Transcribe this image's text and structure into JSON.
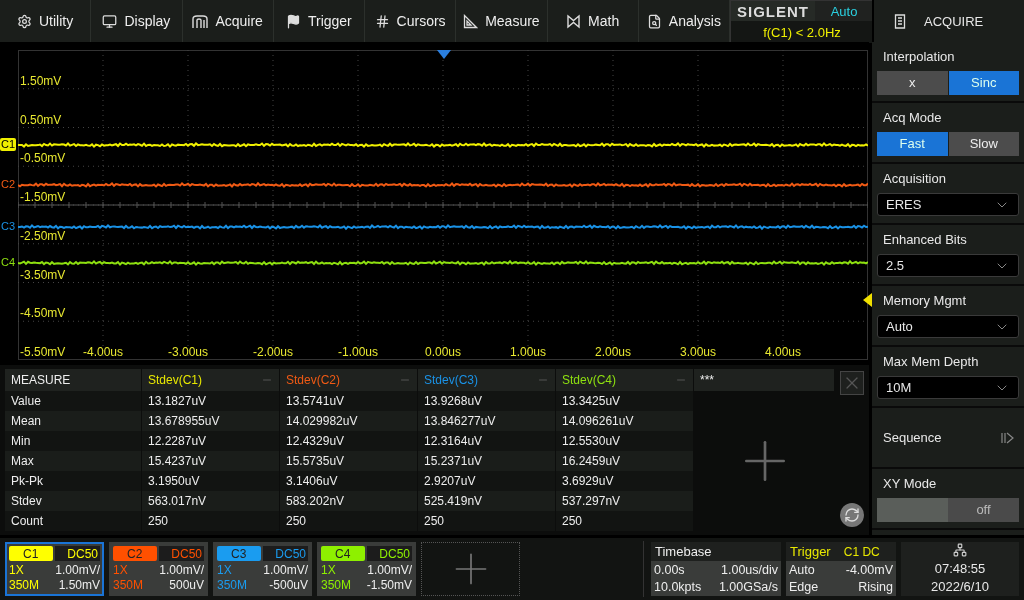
{
  "menu": [
    {
      "label": "Utility",
      "kind": "gear"
    },
    {
      "label": "Display",
      "kind": "monitor"
    },
    {
      "label": "Acquire",
      "kind": "acquire"
    },
    {
      "label": "Trigger",
      "kind": "flag"
    },
    {
      "label": "Cursors",
      "kind": "cursors"
    },
    {
      "label": "Measure",
      "kind": "measure"
    },
    {
      "label": "Math",
      "kind": "math"
    },
    {
      "label": "Analysis",
      "kind": "analysis"
    }
  ],
  "brand": {
    "logo": "SIGLENT",
    "trigger_status": "Auto",
    "frequency": "f(C1) < 2.0Hz"
  },
  "scope": {
    "y_labels": [
      "1.50mV",
      "0.50mV",
      "-0.50mV",
      "-1.50mV",
      "-2.50mV",
      "-3.50mV",
      "-4.50mV",
      "-5.50mV"
    ],
    "x_labels": [
      "-4.00us",
      "-3.00us",
      "-2.00us",
      "-1.00us",
      "0.00us",
      "1.00us",
      "2.00us",
      "3.00us",
      "4.00us"
    ],
    "traces": [
      {
        "label": "C1",
        "color": "#f0f000",
        "selected": true
      },
      {
        "label": "C2",
        "color": "#f05a14",
        "selected": false
      },
      {
        "label": "C3",
        "color": "#1a92e6",
        "selected": false
      },
      {
        "label": "C4",
        "color": "#8ee010",
        "selected": false
      }
    ]
  },
  "measure": {
    "title": "MEASURE",
    "columns": [
      {
        "label": "Stdev(C1)",
        "color": "#e8e800"
      },
      {
        "label": "Stdev(C2)",
        "color": "#f05a14"
      },
      {
        "label": "Stdev(C3)",
        "color": "#1a92e6"
      },
      {
        "label": "Stdev(C4)",
        "color": "#8ee010"
      }
    ],
    "extra_column": "***",
    "rows": [
      {
        "label": "Value",
        "cells": [
          "13.1827uV",
          "13.5741uV",
          "13.9268uV",
          "13.3425uV"
        ]
      },
      {
        "label": "Mean",
        "cells": [
          "13.678955uV",
          "14.029982uV",
          "13.846277uV",
          "14.096261uV"
        ]
      },
      {
        "label": "Min",
        "cells": [
          "12.2287uV",
          "12.4329uV",
          "12.3164uV",
          "12.5530uV"
        ]
      },
      {
        "label": "Max",
        "cells": [
          "15.4237uV",
          "15.5735uV",
          "15.2371uV",
          "16.2459uV"
        ]
      },
      {
        "label": "Pk-Pk",
        "cells": [
          "3.1950uV",
          "3.1406uV",
          "2.9207uV",
          "3.6929uV"
        ]
      },
      {
        "label": "Stdev",
        "cells": [
          "563.017nV",
          "583.202nV",
          "525.419nV",
          "537.297nV"
        ]
      },
      {
        "label": "Count",
        "cells": [
          "250",
          "250",
          "250",
          "250"
        ]
      }
    ]
  },
  "panel": {
    "title": "ACQUIRE",
    "items": [
      {
        "kind": "toggle",
        "label": "Interpolation",
        "options": [
          {
            "label": "x",
            "selected": false
          },
          {
            "label": "Sinc",
            "selected": true
          }
        ]
      },
      {
        "kind": "toggle",
        "label": "Acq Mode",
        "options": [
          {
            "label": "Fast",
            "selected": true
          },
          {
            "label": "Slow",
            "selected": false
          }
        ]
      },
      {
        "kind": "dropdown",
        "label": "Acquisition",
        "value": "ERES"
      },
      {
        "kind": "dropdown",
        "label": "Enhanced Bits",
        "value": "2.5"
      },
      {
        "kind": "dropdown",
        "label": "Memory Mgmt",
        "value": "Auto"
      },
      {
        "kind": "dropdown",
        "label": "Max Mem Depth",
        "value": "10M"
      },
      {
        "kind": "link",
        "label": "Sequence"
      },
      {
        "kind": "switch",
        "label": "XY Mode",
        "state_label": "off",
        "on": false
      }
    ]
  },
  "channels": [
    {
      "name": "C1",
      "coupling": "DC50",
      "color": "#ffff00",
      "probe": "1X",
      "scale": "1.00mV/",
      "bandwidth": "350M",
      "offset": "1.50mV",
      "selected": true
    },
    {
      "name": "C2",
      "coupling": "DC50",
      "color": "#ff5000",
      "probe": "1X",
      "scale": "1.00mV/",
      "bandwidth": "350M",
      "offset": "500uV",
      "selected": false
    },
    {
      "name": "C3",
      "coupling": "DC50",
      "color": "#1a9cf0",
      "probe": "1X",
      "scale": "1.00mV/",
      "bandwidth": "350M",
      "offset": "-500uV",
      "selected": false
    },
    {
      "name": "C4",
      "coupling": "DC50",
      "color": "#8ef000",
      "probe": "1X",
      "scale": "1.00mV/",
      "bandwidth": "350M",
      "offset": "-1.50mV",
      "selected": false
    }
  ],
  "timebase": {
    "title": "Timebase",
    "delay": "0.00s",
    "scale": "1.00us/div",
    "points": "10.0kpts",
    "sample_rate": "1.00GSa/s"
  },
  "trigger": {
    "title": "Trigger",
    "source": "C1 DC",
    "mode": "Auto",
    "level": "-4.00mV",
    "type": "Edge",
    "slope": "Rising"
  },
  "clock": {
    "time": "07:48:55",
    "date": "2022/6/10"
  }
}
